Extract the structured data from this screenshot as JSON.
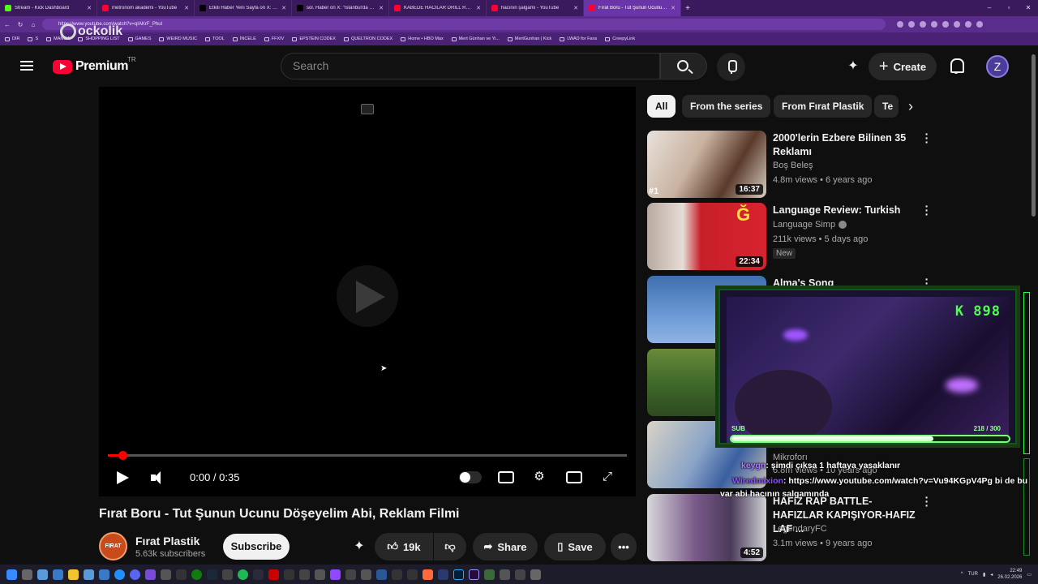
{
  "browser": {
    "tabs": [
      {
        "label": "Stream - Kick Dashboard",
        "color": "#53fc18"
      },
      {
        "label": "metronom akademi - YouTube",
        "color": "#ff0033"
      },
      {
        "label": "Etkili Haber Yeni Sayfa on X: \"Murat",
        "color": "#000000"
      },
      {
        "label": "sol. Haber on X: \"İstanbul'da ortaö",
        "color": "#000000"
      },
      {
        "label": "KABEDE HACILAR DRILL REMIX(prod.",
        "color": "#ff0033"
      },
      {
        "label": "hacının şalgamı - YouTube",
        "color": "#ff0033"
      },
      {
        "label": "Fırat Boru - Tut Şunun Ucunu Döşe",
        "color": "#ff0033"
      }
    ],
    "url": "https://www.youtube.com/watch?v=qIAKrF_Phul",
    "bookmarks": [
      "DIR",
      "S",
      "MANGA",
      "SHOPPING LIST",
      "GAMES",
      "WEIRD MUSIC",
      "TOOL",
      "İNCELE",
      "FFXIV",
      "EPSTEIN CODEX",
      "QUELTRON CODEX",
      "Home • HBO Max",
      "Mert Günhan ve Yi...",
      "MertGunhan | Kick",
      "LWAD for Fans",
      "CreepyLink"
    ]
  },
  "watermark": "ockolik",
  "header": {
    "brand": "Premium",
    "country": "TR",
    "search_placeholder": "Search",
    "create_label": "Create",
    "avatar_letter": "Z"
  },
  "player": {
    "time": "0:00 / 0:35",
    "progress_fraction": 0.028
  },
  "video": {
    "title": "Fırat Boru - Tut Şunun Ucunu Döşeyelim Abi, Reklam Filmi",
    "channel": "Fırat Plastik",
    "channel_avatar_text": "FIRAT",
    "subscribers": "5.63k subscribers",
    "subscribe_label": "Subscribe",
    "likes": "19k",
    "share_label": "Share",
    "save_label": "Save"
  },
  "chips": [
    "All",
    "From the series",
    "From Fırat Plastik",
    "Te"
  ],
  "recommendations": [
    {
      "title": "2000'lerin Ezbere Bilinen 35 Reklamı",
      "channel": "Boş Beleş",
      "meta": "4.8m views • 6 years ago",
      "duration": "16:37",
      "rank": "#1",
      "verified": false,
      "badge": ""
    },
    {
      "title": "Language Review: Turkish",
      "channel": "Language Simp",
      "meta": "211k views • 5 days ago",
      "duration": "22:34",
      "rank": "",
      "verified": true,
      "badge": "New"
    },
    {
      "title": "Alma's Song",
      "channel": "",
      "meta": "",
      "duration": "",
      "rank": "",
      "verified": false,
      "badge": ""
    },
    {
      "title": "",
      "channel": "",
      "meta": "",
      "duration": "",
      "rank": "",
      "verified": false,
      "badge": ""
    },
    {
      "title": "",
      "channel": "Mikroforı",
      "meta": "6.8m views • 10 years ago",
      "duration": "",
      "rank": "",
      "verified": false,
      "badge": ""
    },
    {
      "title": "HAFIZ RAP BATTLE-HAFIZLAR KAPIŞIYOR-HAFIZ LAF ...",
      "channel": "LegendaryFC",
      "meta": "3.1m views • 9 years ago",
      "duration": "4:52",
      "rank": "",
      "verified": false,
      "badge": ""
    }
  ],
  "overlay": {
    "counter": "K 898",
    "sub_label": "SUB",
    "sub_count": "218 / 300",
    "sub_fraction": 0.727
  },
  "chat": [
    {
      "user": "keygn",
      "message": ": şimdi çıksa 1 haftaya yasaklanır"
    },
    {
      "user": "Wiredmixion",
      "message": ": https://www.youtube.com/watch?v=Vu94KGpV4Pg bi de bu"
    },
    {
      "user": "",
      "message": "var abi hacının salgamında"
    }
  ],
  "taskbar": {
    "lang": "TUR",
    "time": "22:49",
    "date": "26.02.2026"
  }
}
